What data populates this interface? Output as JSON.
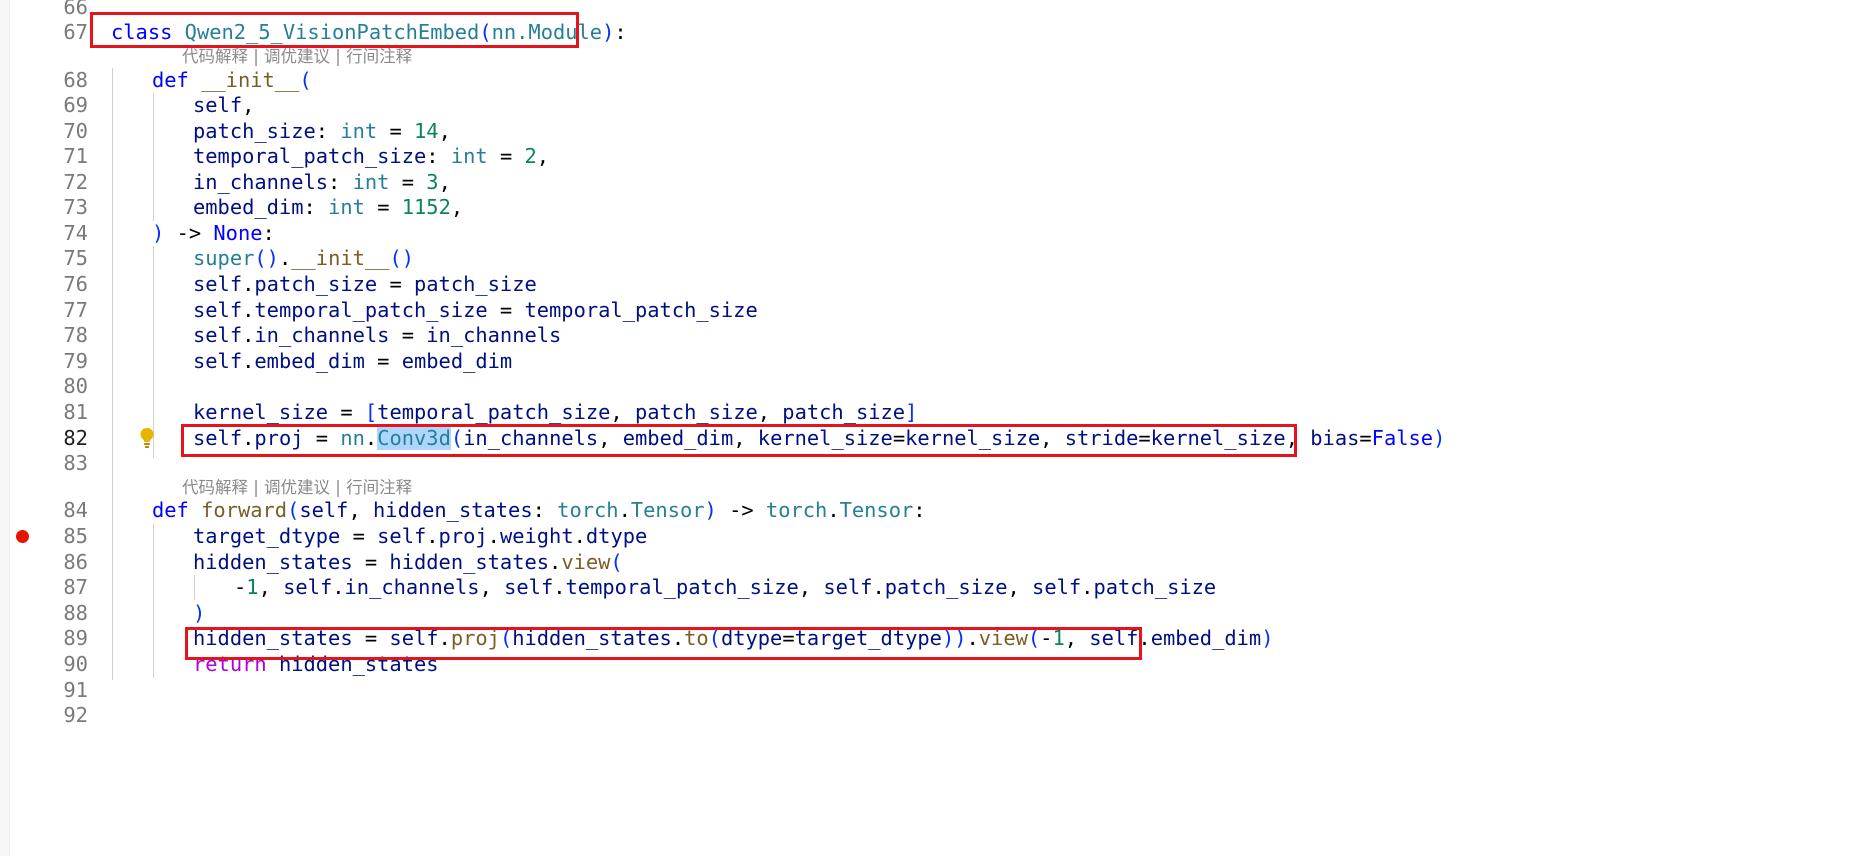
{
  "editor": {
    "lines": [
      {
        "n": "66",
        "text": ""
      },
      {
        "n": "67",
        "text": "class Qwen2_5_VisionPatchEmbed(nn.Module):"
      },
      {
        "n": "68",
        "text": "    def __init__("
      },
      {
        "n": "69",
        "text": "        self,"
      },
      {
        "n": "70",
        "text": "        patch_size: int = 14,"
      },
      {
        "n": "71",
        "text": "        temporal_patch_size: int = 2,"
      },
      {
        "n": "72",
        "text": "        in_channels: int = 3,"
      },
      {
        "n": "73",
        "text": "        embed_dim: int = 1152,"
      },
      {
        "n": "74",
        "text": "    ) -> None:"
      },
      {
        "n": "75",
        "text": "        super().__init__()"
      },
      {
        "n": "76",
        "text": "        self.patch_size = patch_size"
      },
      {
        "n": "77",
        "text": "        self.temporal_patch_size = temporal_patch_size"
      },
      {
        "n": "78",
        "text": "        self.in_channels = in_channels"
      },
      {
        "n": "79",
        "text": "        self.embed_dim = embed_dim"
      },
      {
        "n": "80",
        "text": ""
      },
      {
        "n": "81",
        "text": "        kernel_size = [temporal_patch_size, patch_size, patch_size]"
      },
      {
        "n": "82",
        "text": "        self.proj = nn.Conv3d(in_channels, embed_dim, kernel_size=kernel_size, stride=kernel_size, bias=False)"
      },
      {
        "n": "83",
        "text": ""
      },
      {
        "n": "84",
        "text": "    def forward(self, hidden_states: torch.Tensor) -> torch.Tensor:"
      },
      {
        "n": "85",
        "text": "        target_dtype = self.proj.weight.dtype"
      },
      {
        "n": "86",
        "text": "        hidden_states = hidden_states.view("
      },
      {
        "n": "87",
        "text": "            -1, self.in_channels, self.temporal_patch_size, self.patch_size, self.patch_size"
      },
      {
        "n": "88",
        "text": "        )"
      },
      {
        "n": "89",
        "text": "        hidden_states = self.proj(hidden_states.to(dtype=target_dtype)).view(-1, self.embed_dim)"
      },
      {
        "n": "90",
        "text": "        return hidden_states"
      },
      {
        "n": "91",
        "text": ""
      },
      {
        "n": "92",
        "text": ""
      }
    ],
    "codelens": [
      {
        "before_line": "68",
        "text": "代码解释 | 调优建议 | 行间注释"
      },
      {
        "before_line": "84",
        "text": "代码解释 | 调优建议 | 行间注释"
      }
    ],
    "active_line": "82",
    "selected_word": "Conv3d",
    "breakpoint_line": "85",
    "lightbulb_line": "82",
    "highlighted_lines": [
      "67",
      "82",
      "89"
    ],
    "colors": {
      "highlight_box": "#e3141c",
      "breakpoint": "#e51400",
      "lightbulb": "#e8b400",
      "selection": "#add6ff"
    }
  }
}
